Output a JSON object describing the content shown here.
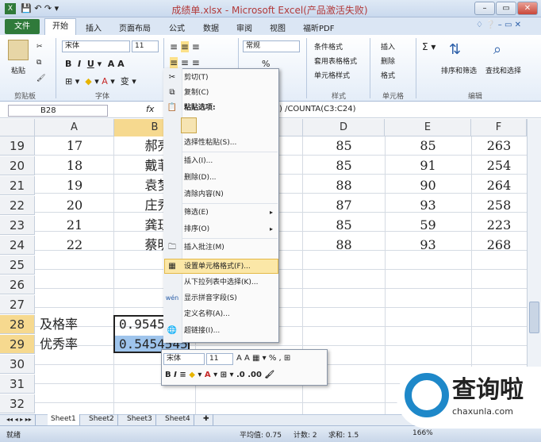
{
  "window": {
    "title": "成绩单.xlsx - Microsoft Excel(产品激活失败)"
  },
  "tabs": [
    "文件",
    "开始",
    "插入",
    "页面布局",
    "公式",
    "数据",
    "审阅",
    "视图",
    "福昕PDF"
  ],
  "ribbon": {
    "paste": "粘贴",
    "clipboard_group": "剪贴板",
    "font_group": "字体",
    "font_name": "宋体",
    "font_size": "11",
    "number_format": "常规",
    "cond_format": "条件格式",
    "table_format": "套用表格格式",
    "cell_style": "单元格样式",
    "insert": "插入",
    "delete": "删除",
    "format": "格式",
    "styles_group": "样式",
    "cells_group": "单元格",
    "sort_filter": "排序和筛选",
    "find_select": "查找和选择",
    "edit_group": "编辑"
  },
  "formula_bar": {
    "name_box": "B28",
    "fx": "fx",
    "formula": ") /COUNTA(C3:C24)"
  },
  "columns": [
    "A",
    "B",
    "C",
    "D",
    "E",
    "F"
  ],
  "rows": [
    {
      "num": "19",
      "a": "17",
      "b": "郝亮",
      "d": "85",
      "e": "85",
      "f": "263"
    },
    {
      "num": "20",
      "a": "18",
      "b": "戴菲",
      "d": "85",
      "e": "91",
      "f": "254"
    },
    {
      "num": "21",
      "a": "19",
      "b": "袁梦",
      "d": "88",
      "e": "90",
      "f": "264"
    },
    {
      "num": "22",
      "a": "20",
      "b": "庄秀",
      "d": "87",
      "e": "93",
      "f": "258"
    },
    {
      "num": "23",
      "a": "21",
      "b": "龚珏",
      "d": "85",
      "e": "59",
      "f": "223"
    },
    {
      "num": "24",
      "a": "22",
      "b": "蔡明",
      "d": "88",
      "e": "93",
      "f": "268"
    },
    {
      "num": "25",
      "a": "",
      "b": "",
      "d": "",
      "e": "",
      "f": ""
    },
    {
      "num": "26",
      "a": "",
      "b": "",
      "d": "",
      "e": "",
      "f": ""
    },
    {
      "num": "27",
      "a": "",
      "b": "",
      "d": "",
      "e": "",
      "f": ""
    },
    {
      "num": "28",
      "a": "及格率",
      "b": "0.9545",
      "d": "",
      "e": "",
      "f": ""
    },
    {
      "num": "29",
      "a": "优秀率",
      "b": "0.5454545",
      "d": "",
      "e": "",
      "f": ""
    },
    {
      "num": "30",
      "a": "",
      "b": "",
      "d": "",
      "e": "",
      "f": ""
    },
    {
      "num": "31",
      "a": "",
      "b": "",
      "d": "",
      "e": "",
      "f": ""
    },
    {
      "num": "32",
      "a": "",
      "b": "",
      "d": "",
      "e": "",
      "f": ""
    }
  ],
  "context_menu": [
    "剪切(T)",
    "复制(C)",
    "粘贴选项:",
    "选择性粘贴(S)...",
    "插入(I)...",
    "删除(D)...",
    "清除内容(N)",
    "筛选(E)",
    "排序(O)",
    "插入批注(M)",
    "设置单元格格式(F)...",
    "从下拉列表中选择(K)...",
    "显示拼音字段(S)",
    "定义名称(A)...",
    "超链接(I)..."
  ],
  "mini_toolbar": {
    "font": "宋体",
    "size": "11"
  },
  "sheets": [
    "Sheet1",
    "Sheet2",
    "Sheet3",
    "Sheet4"
  ],
  "status": {
    "ready": "就绪",
    "average": "平均值: 0.75",
    "count": "计数: 2",
    "sum": "求和: 1.5",
    "zoom": "166%"
  },
  "watermark": {
    "brand": "查询啦",
    "url": "chaxunla.com"
  }
}
